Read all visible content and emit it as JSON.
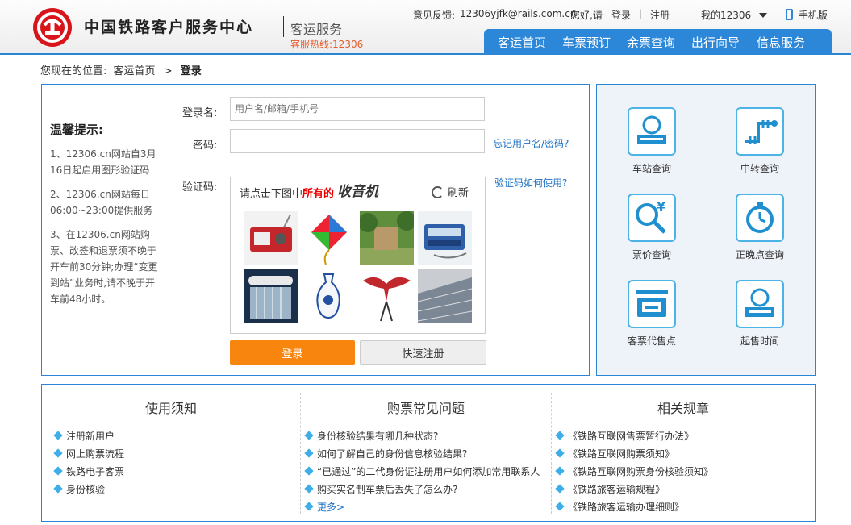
{
  "header": {
    "brand": "中国铁路客户服务中心",
    "service": "客运服务",
    "hotline": "客服热线:12306",
    "feedback_label": "意见反馈:",
    "feedback_email": "12306yjfk@rails.com.cn",
    "greeting": "您好,请",
    "login_link": "登录",
    "separator": "|",
    "register_link": "注册",
    "my12306": "我的12306",
    "mobile": "手机版",
    "nav": [
      "客运首页",
      "车票预订",
      "余票查询",
      "出行向导",
      "信息服务"
    ]
  },
  "breadcrumb": {
    "prefix": "您现在的位置:",
    "home": "客运首页",
    "arrow": ">",
    "current": "登录"
  },
  "tips": {
    "title": "温馨提示:",
    "items": [
      "1、12306.cn网站自3月16日起启用图形验证码",
      "2、12306.cn网站每日06:00~23:00提供服务",
      "3、在12306.cn网站购票、改签和退票须不晚于开车前30分钟;办理“变更到站”业务时,请不晚于开车前48小时。"
    ]
  },
  "form": {
    "username_label": "登录名:",
    "username_placeholder": "用户名/邮箱/手机号",
    "password_label": "密码:",
    "forgot_link": "忘记用户名/密码?",
    "captcha_label": "验证码:",
    "captcha_help": "验证码如何使用?",
    "captcha_prompt_pre": "请点击下图中",
    "captcha_prompt_em": "所有的",
    "captcha_word": "收音机",
    "refresh": "刷新",
    "login_button": "登录",
    "register_button": "快速注册"
  },
  "quick": [
    {
      "label": "车站查询",
      "icon": "station-icon"
    },
    {
      "label": "中转查询",
      "icon": "transfer-icon"
    },
    {
      "label": "票价查询",
      "icon": "price-search-icon"
    },
    {
      "label": "正晚点查询",
      "icon": "clock-icon"
    },
    {
      "label": "客票代售点",
      "icon": "ticket-agent-icon"
    },
    {
      "label": "起售时间",
      "icon": "sale-time-icon"
    }
  ],
  "info": {
    "columns": [
      {
        "title": "使用须知",
        "items": [
          "注册新用户",
          "网上购票流程",
          "铁路电子客票",
          "身份核验"
        ]
      },
      {
        "title": "购票常见问题",
        "items": [
          "身份核验结果有哪几种状态?",
          "如何了解自己的身份信息核验结果?",
          "“已通过”的二代身份证注册用户如何添加常用联系人",
          "购买实名制车票后丢失了怎么办?"
        ],
        "more": "更多>"
      },
      {
        "title": "相关规章",
        "items": [
          "《铁路互联网售票暂行办法》",
          "《铁路互联网购票须知》",
          "《铁路互联网购票身份核验须知》",
          "《铁路旅客运输规程》",
          "《铁路旅客运输办理细则》"
        ]
      }
    ]
  },
  "colors": {
    "accent_blue": "#2d87d8",
    "login_orange": "#f7850e",
    "brand_red": "#d7151b",
    "icon_cyan": "#4bb3e6"
  }
}
